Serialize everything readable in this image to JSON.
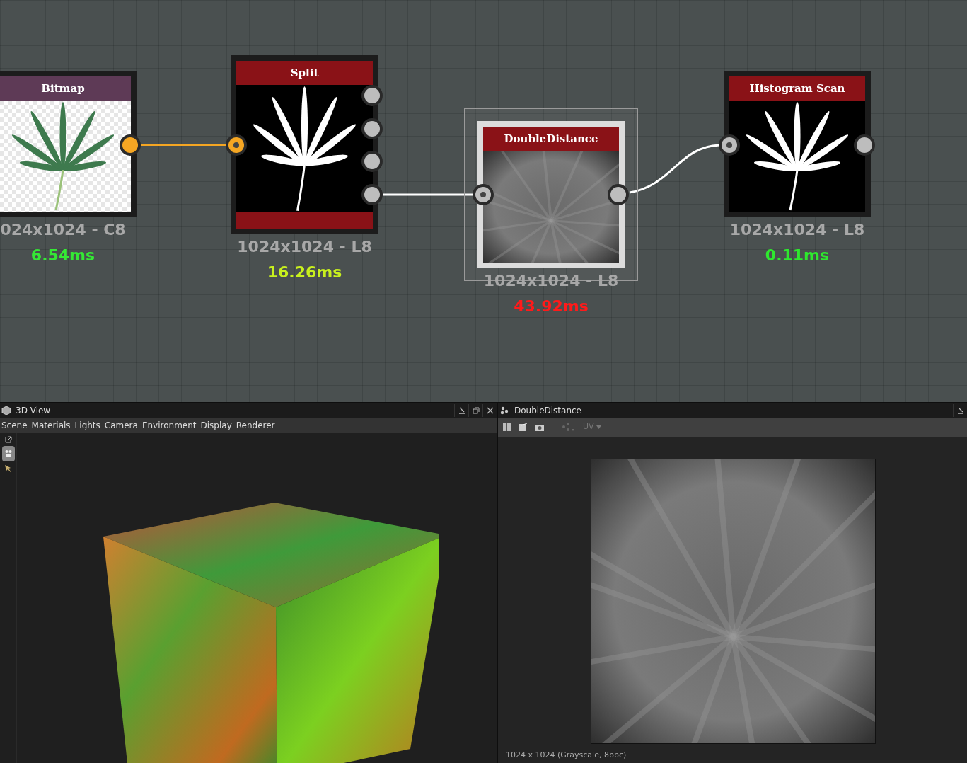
{
  "canvas": {
    "nodes": [
      {
        "title": "Bitmap",
        "kind": "input",
        "preview": {
          "kind": "bitmap"
        },
        "bottom_bar": false,
        "selected": false,
        "resolution": "024x1024 - C8",
        "time": "6.54ms",
        "color": "#35e835",
        "outputs": [
          {
            "kind": "color"
          }
        ]
      },
      {
        "title": "Split",
        "kind": "filter",
        "preview": {
          "kind": "mask"
        },
        "bottom_bar": true,
        "selected": false,
        "resolution": "1024x1024 - L8",
        "time": "16.26ms",
        "color": "#c8f01e",
        "inputs": [
          {
            "kind": "color"
          }
        ],
        "outputs": [
          {
            "kind": "grayscale"
          },
          {
            "kind": "grayscale"
          },
          {
            "kind": "grayscale"
          },
          {
            "kind": "grayscale"
          }
        ]
      },
      {
        "title": "DoubleDistance",
        "kind": "filter",
        "preview": {
          "kind": "distance"
        },
        "bottom_bar": false,
        "selected": true,
        "resolution": "1024x1024 - L8",
        "time": "43.92ms",
        "color": "#ff1a1a",
        "inputs": [
          {
            "kind": "grayscale"
          }
        ],
        "outputs": [
          {
            "kind": "grayscale"
          }
        ]
      },
      {
        "title": "Histogram Scan",
        "kind": "filter",
        "preview": {
          "kind": "mask"
        },
        "bottom_bar": false,
        "selected": false,
        "resolution": "1024x1024 - L8",
        "time": "0.11ms",
        "color": "#2ee82e",
        "inputs": [
          {
            "kind": "grayscale"
          }
        ],
        "outputs": [
          {
            "kind": "grayscale"
          }
        ]
      }
    ]
  },
  "view_3d": {
    "title": "3D View",
    "menu": [
      "Scene",
      "Materials",
      "Lights",
      "Camera",
      "Environment",
      "Display",
      "Renderer"
    ]
  },
  "viewer_2d": {
    "title": "DoubleDistance",
    "uv_label": "UV",
    "status": "1024 x 1024 (Grayscale, 8bpc)"
  }
}
